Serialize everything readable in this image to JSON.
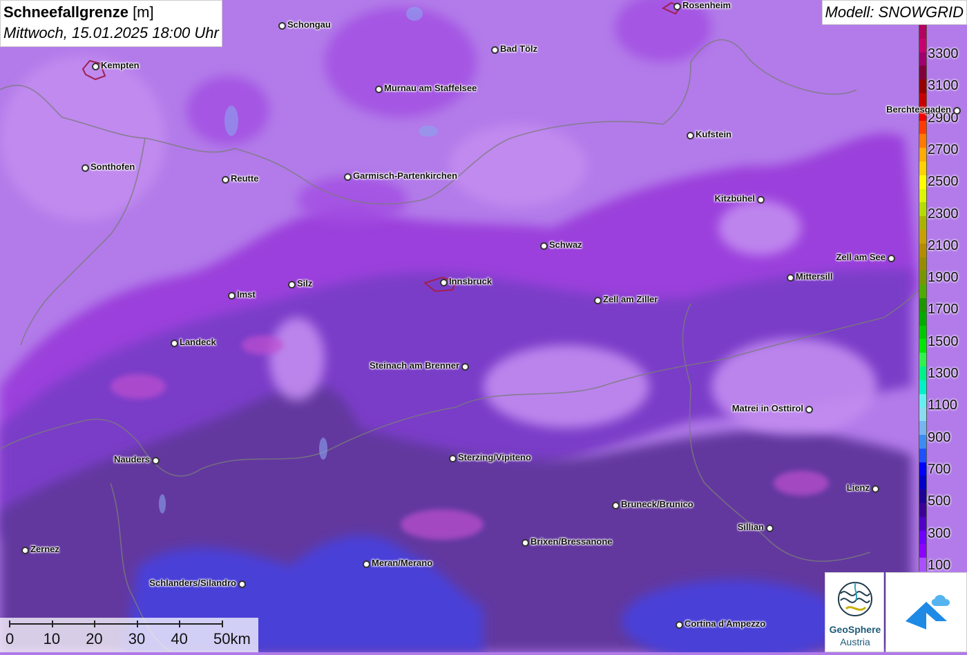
{
  "title": {
    "main": "Schneefallgrenze",
    "unit": " [m]",
    "date": "Mittwoch, 15.01.2025 18:00 Uhr"
  },
  "model": "Modell: SNOWGRID",
  "legend": {
    "labels": [
      "3300",
      "3100",
      "2900",
      "2700",
      "2500",
      "2300",
      "2100",
      "1900",
      "1700",
      "1500",
      "1300",
      "1100",
      "900",
      "700",
      "500",
      "300",
      "100"
    ],
    "colors": [
      "#b4005f",
      "#c8006e",
      "#a0006e",
      "#80003c",
      "#960000",
      "#c80000",
      "#f00000",
      "#ff3c00",
      "#ff7800",
      "#ffaa00",
      "#ffd200",
      "#ffff00",
      "#dcf500",
      "#b4dc00",
      "#aab400",
      "#c8a000",
      "#b48c00",
      "#968c00",
      "#789600",
      "#50aa00",
      "#1e9600",
      "#00aa00",
      "#00c800",
      "#00e600",
      "#32f050",
      "#00f08c",
      "#00f0c8",
      "#64f0f0",
      "#8cdcf0",
      "#78b4f0",
      "#3c8cf0",
      "#1e50ff",
      "#0000ff",
      "#0000c8",
      "#1e0096",
      "#3c0096",
      "#5000c8",
      "#6e00ff",
      "#8c00ff",
      "#aa50ff"
    ]
  },
  "cities": [
    {
      "name": "Rosenheim"
    },
    {
      "name": "Schongau"
    },
    {
      "name": "Bad Tölz"
    },
    {
      "name": "Kempten"
    },
    {
      "name": "Murnau am Staffelsee"
    },
    {
      "name": "Berchtesgaden"
    },
    {
      "name": "Kufstein"
    },
    {
      "name": "Sonthofen"
    },
    {
      "name": "Reutte"
    },
    {
      "name": "Garmisch-Partenkirchen"
    },
    {
      "name": "Kitzbühel"
    },
    {
      "name": "Schwaz"
    },
    {
      "name": "Zell am See"
    },
    {
      "name": "Mittersill"
    },
    {
      "name": "Innsbruck"
    },
    {
      "name": "Silz"
    },
    {
      "name": "Imst"
    },
    {
      "name": "Zell am Ziller"
    },
    {
      "name": "Landeck"
    },
    {
      "name": "Steinach am Brenner"
    },
    {
      "name": "Matrei in Osttirol"
    },
    {
      "name": "Nauders"
    },
    {
      "name": "Sterzing/Vipiteno"
    },
    {
      "name": "Lienz"
    },
    {
      "name": "Bruneck/Brunico"
    },
    {
      "name": "Sillian"
    },
    {
      "name": "Brixen/Bressanone"
    },
    {
      "name": "Zernez"
    },
    {
      "name": "Meran/Merano"
    },
    {
      "name": "Schlanders/Silandro"
    },
    {
      "name": "Cortina d'Ampezzo"
    }
  ],
  "scale": {
    "labels": [
      "0",
      "10",
      "20",
      "30",
      "40",
      "50km"
    ]
  },
  "logos": {
    "geosphere_line1": "GeoSphere",
    "geosphere_line2": "Austria"
  }
}
